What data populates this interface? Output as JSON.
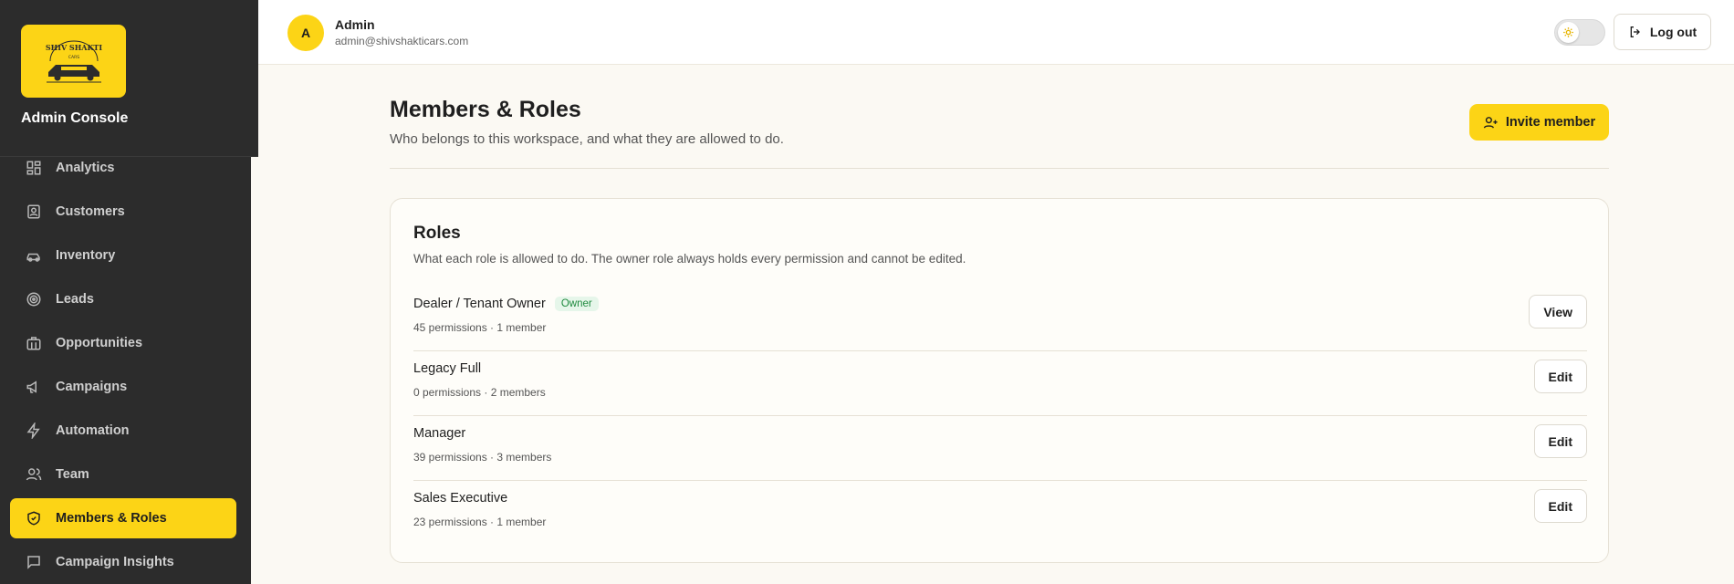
{
  "sidebar": {
    "logo_alt": "Shiv Shakti Cars logo",
    "title": "Admin Console",
    "items": [
      {
        "label": "Analytics",
        "icon": "grid-icon",
        "active": false
      },
      {
        "label": "Customers",
        "icon": "id-card-icon",
        "active": false
      },
      {
        "label": "Inventory",
        "icon": "car-icon",
        "active": false
      },
      {
        "label": "Leads",
        "icon": "target-icon",
        "active": false
      },
      {
        "label": "Opportunities",
        "icon": "briefcase-icon",
        "active": false
      },
      {
        "label": "Campaigns",
        "icon": "megaphone-icon",
        "active": false
      },
      {
        "label": "Automation",
        "icon": "lightning-icon",
        "active": false
      },
      {
        "label": "Team",
        "icon": "users-icon",
        "active": false
      },
      {
        "label": "Members & Roles",
        "icon": "shield-check-icon",
        "active": true
      },
      {
        "label": "Campaign Insights",
        "icon": "message-square-icon",
        "active": false
      }
    ]
  },
  "header": {
    "avatar_initial": "A",
    "user_name": "Admin",
    "user_email": "admin@shivshakticars.com",
    "theme_icon": "sun-icon",
    "logout_label": "Log out"
  },
  "main": {
    "title": "Members & Roles",
    "subtitle": "Who belongs to this workspace, and what they are allowed to do.",
    "invite_label": "Invite member",
    "roles_card": {
      "title": "Roles",
      "description": "What each role is allowed to do. The owner role always holds every permission and cannot be edited.",
      "roles": [
        {
          "name": "Dealer / Tenant Owner",
          "badge": "Owner",
          "meta": "45 permissions · 1 member",
          "action": "View"
        },
        {
          "name": "Legacy Full",
          "badge": "",
          "meta": "0 permissions · 2 members",
          "action": "Edit"
        },
        {
          "name": "Manager",
          "badge": "",
          "meta": "39 permissions · 3 members",
          "action": "Edit"
        },
        {
          "name": "Sales Executive",
          "badge": "",
          "meta": "23 permissions · 1 member",
          "action": "Edit"
        }
      ]
    }
  },
  "colors": {
    "accent": "#fcd416",
    "sidebar_bg": "#2c2c2c",
    "page_bg": "#fbf9f3",
    "owner_badge_bg": "#e6f6ea",
    "owner_badge_text": "#1e8a3e"
  }
}
